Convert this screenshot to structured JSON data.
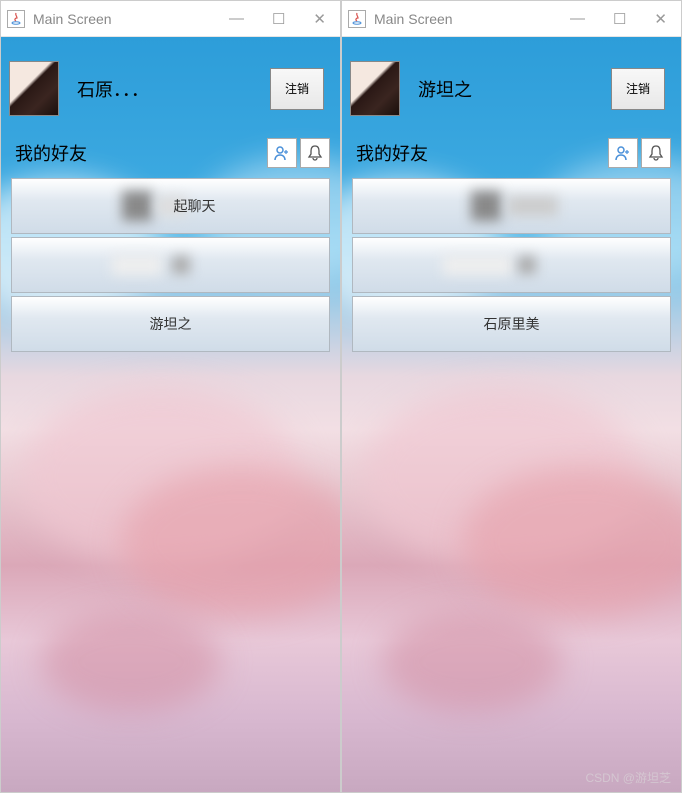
{
  "left": {
    "title": "Main Screen",
    "username": "石原．．．",
    "logout_label": "注销",
    "section": "我的好友",
    "friends": [
      "起聊天",
      "",
      "游坦之"
    ]
  },
  "right": {
    "title": "Main Screen",
    "username": "游坦之",
    "logout_label": "注销",
    "section": "我的好友",
    "friends": [
      "",
      "",
      "石原里美"
    ]
  },
  "watermark": "CSDN @游坦芝"
}
